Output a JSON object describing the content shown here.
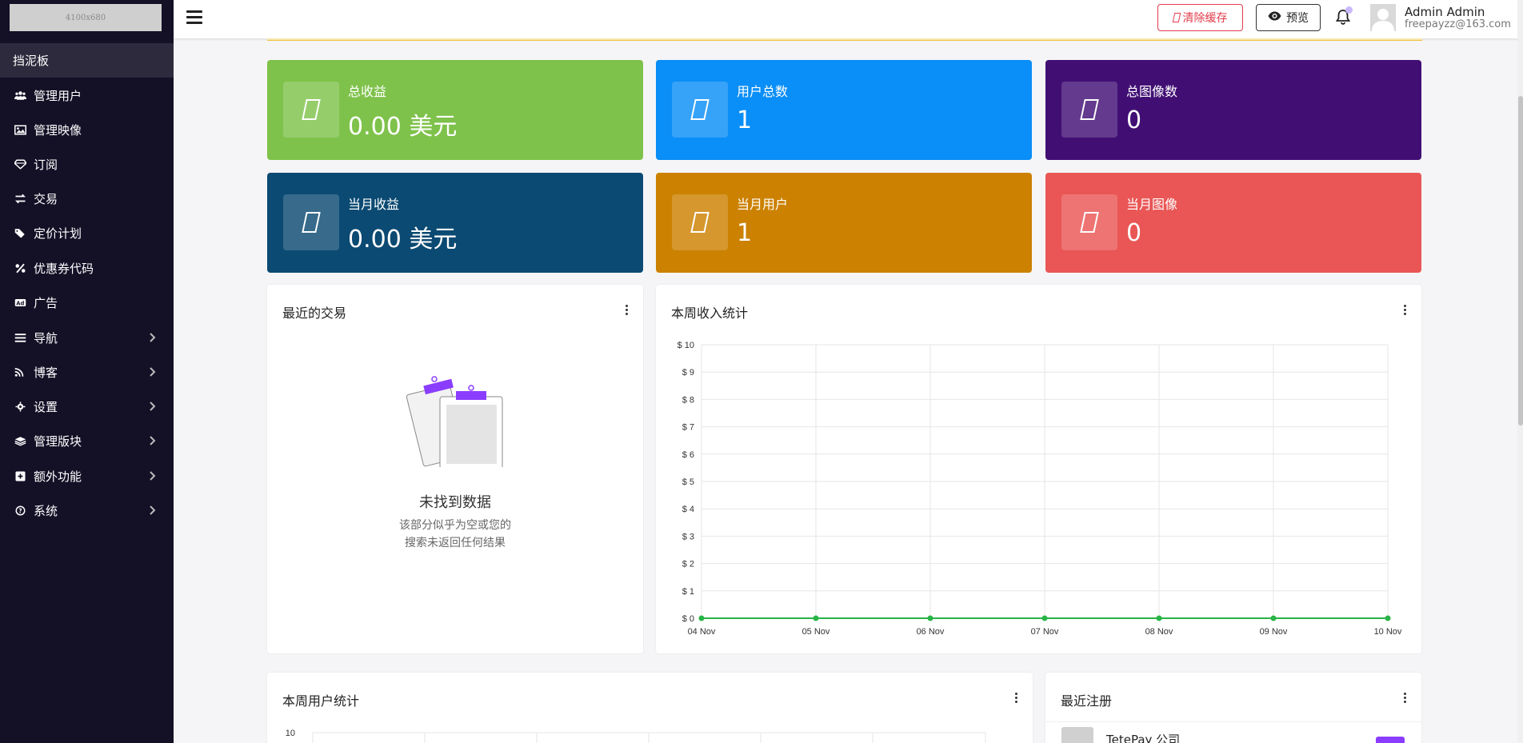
{
  "sidebar": {
    "logo_text": "4100x680",
    "items": [
      {
        "label": "挡泥板",
        "icon": "none",
        "active": true,
        "chevron": false
      },
      {
        "label": "管理用户",
        "icon": "users-icon",
        "chevron": false
      },
      {
        "label": "管理映像",
        "icon": "image-icon",
        "chevron": false
      },
      {
        "label": "订阅",
        "icon": "gem-icon",
        "chevron": false
      },
      {
        "label": "交易",
        "icon": "exchange-icon",
        "chevron": false
      },
      {
        "label": "定价计划",
        "icon": "tags-icon",
        "chevron": false
      },
      {
        "label": "优惠券代码",
        "icon": "percent-icon",
        "chevron": false
      },
      {
        "label": "广告",
        "icon": "ad-icon",
        "chevron": false
      },
      {
        "label": "导航",
        "icon": "bars-icon",
        "chevron": true
      },
      {
        "label": "博客",
        "icon": "rss-icon",
        "chevron": true
      },
      {
        "label": "设置",
        "icon": "gear-icon",
        "chevron": true
      },
      {
        "label": "管理版块",
        "icon": "layers-icon",
        "chevron": true
      },
      {
        "label": "额外功能",
        "icon": "plus-square-icon",
        "chevron": true
      },
      {
        "label": "系统",
        "icon": "question-icon",
        "chevron": true
      }
    ]
  },
  "topbar": {
    "clear_cache_label": "清除缓存",
    "preview_label": "预览",
    "user_name": "Admin Admin",
    "user_email": "freepayzz@163.com"
  },
  "stats": [
    {
      "title": "总收益",
      "value": "0.00 美元",
      "color": "#7fc24b"
    },
    {
      "title": "用户总数",
      "value": "1",
      "color": "#0a8ef7"
    },
    {
      "title": "总图像数",
      "value": "0",
      "color": "#410f74"
    },
    {
      "title": "当月收益",
      "value": "0.00 美元",
      "color": "#0b4a72"
    },
    {
      "title": "当月用户",
      "value": "1",
      "color": "#cc8100"
    },
    {
      "title": "当月图像",
      "value": "0",
      "color": "#e95655"
    }
  ],
  "recent_transactions": {
    "title": "最近的交易",
    "empty_title": "未找到数据",
    "empty_desc_line1": "该部分似乎为空或您的",
    "empty_desc_line2": "搜索未返回任何结果"
  },
  "weekly_income": {
    "title": "本周收入统计"
  },
  "weekly_users": {
    "title": "本周用户统计",
    "first_tick": "10"
  },
  "recent_signups": {
    "title": "最近注册",
    "first_name": "TetePay 公司"
  },
  "chart_data": {
    "type": "line",
    "categories": [
      "04 Nov",
      "05 Nov",
      "06 Nov",
      "07 Nov",
      "08 Nov",
      "09 Nov",
      "10 Nov"
    ],
    "values": [
      0,
      0,
      0,
      0,
      0,
      0,
      0
    ],
    "ylim": [
      0,
      10
    ],
    "y_ticks": [
      "$ 0",
      "$ 1",
      "$ 2",
      "$ 3",
      "$ 4",
      "$ 5",
      "$ 6",
      "$ 7",
      "$ 8",
      "$ 9",
      "$ 10"
    ],
    "line_color": "#28b446",
    "grid": true
  }
}
